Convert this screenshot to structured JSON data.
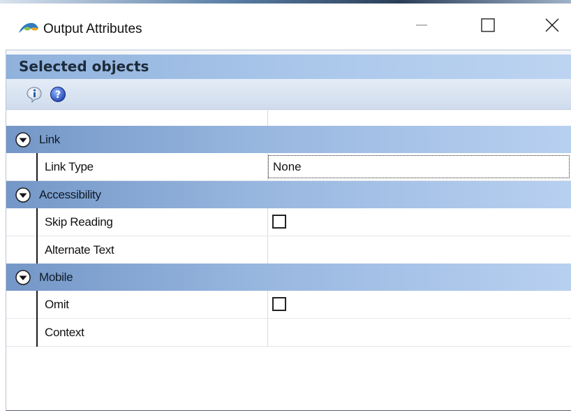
{
  "window": {
    "title": "Output Attributes",
    "controls": {
      "minimize": "minimize",
      "maximize": "maximize",
      "close": "close"
    }
  },
  "panel": {
    "header": "Selected objects",
    "toolbar": [
      {
        "icon": "info-icon",
        "name": "info"
      },
      {
        "icon": "help-icon",
        "name": "help"
      }
    ]
  },
  "categories": [
    {
      "label": "Link",
      "properties": [
        {
          "label": "Link Type",
          "type": "text",
          "value": "None",
          "focused": true
        }
      ]
    },
    {
      "label": "Accessibility",
      "properties": [
        {
          "label": "Skip Reading",
          "type": "checkbox",
          "checked": false
        },
        {
          "label": "Alternate Text",
          "type": "text",
          "value": ""
        }
      ]
    },
    {
      "label": "Mobile",
      "properties": [
        {
          "label": "Omit",
          "type": "checkbox",
          "checked": false
        },
        {
          "label": "Context",
          "type": "text",
          "value": ""
        }
      ]
    }
  ],
  "colors": {
    "panel_header": "#a9c6ea",
    "category_row": "#8faed9",
    "toolbar": "#d8e3f1"
  }
}
